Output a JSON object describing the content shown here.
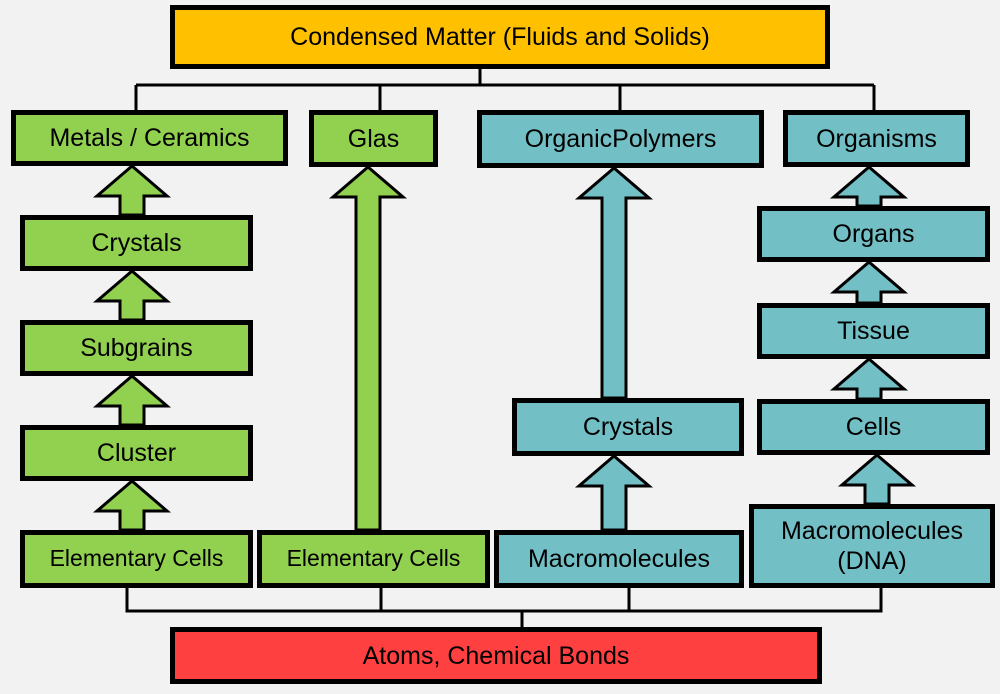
{
  "diagram": {
    "top": {
      "label": "Condensed Matter (Fluids and Solids)",
      "color": "#ffc000"
    },
    "bottom": {
      "label": "Atoms, Chemical Bonds",
      "color": "#ff4040"
    },
    "colors": {
      "inorganic": "#92d050",
      "organic": "#72bfc5",
      "line": "#000000",
      "background": "#f2f2f2"
    },
    "columns": [
      {
        "name": "metals-ceramics",
        "nodes": [
          "Elementary Cells",
          "Cluster",
          "Subgrains",
          "Crystals",
          "Metals / Ceramics"
        ]
      },
      {
        "name": "glas",
        "nodes": [
          "Elementary Cells",
          "Glas"
        ]
      },
      {
        "name": "organic-polymers",
        "nodes": [
          "Macromolecules",
          "Crystals",
          "OrganicPolymers"
        ]
      },
      {
        "name": "organisms",
        "nodes": [
          "Macromolecules\n(DNA)",
          "Cells",
          "Tissue",
          "Organs",
          "Organisms"
        ]
      }
    ]
  }
}
